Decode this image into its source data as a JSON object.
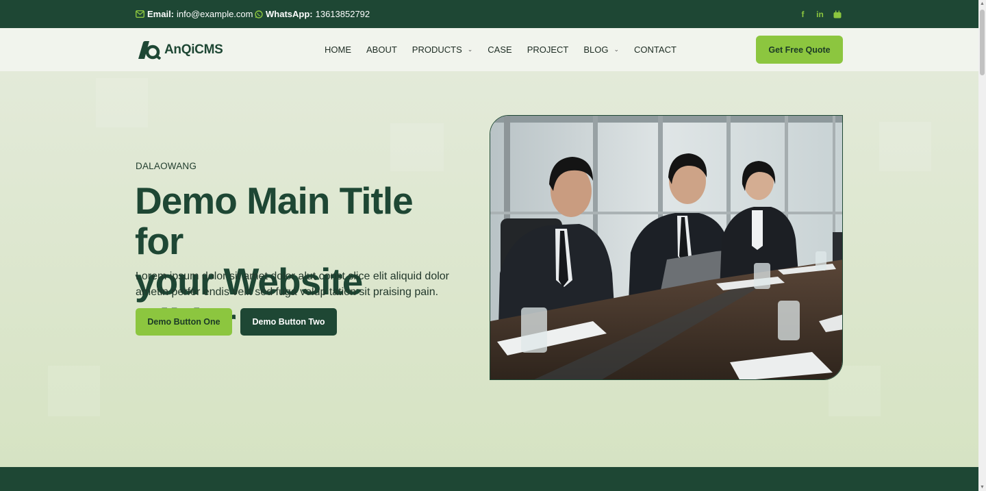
{
  "topbar": {
    "email_label": "Email:",
    "email_value": "info@example.com",
    "whatsapp_label": "WhatsApp:",
    "whatsapp_value": "13613852792",
    "social_icons": [
      "facebook-icon",
      "linkedin-icon",
      "youtube-icon"
    ]
  },
  "header": {
    "logo_text": "AnQiCMS",
    "nav": [
      {
        "label": "HOME",
        "has_dropdown": false
      },
      {
        "label": "ABOUT",
        "has_dropdown": false
      },
      {
        "label": "PRODUCTS",
        "has_dropdown": true
      },
      {
        "label": "CASE",
        "has_dropdown": false
      },
      {
        "label": "PROJECT",
        "has_dropdown": false
      },
      {
        "label": "BLOG",
        "has_dropdown": true
      },
      {
        "label": "CONTACT",
        "has_dropdown": false
      }
    ],
    "quote_button": "Get Free Quote"
  },
  "hero": {
    "eyebrow": "DALAOWANG",
    "title_line1": "Demo Main Title for",
    "title_line2": "your Website Slider",
    "description": "Lorem ipsum dolor sit amet dolor alut const slice elit aliquid dolor ametin perfer endis velit sed fuga volup tation sit praising pain.",
    "button_one": "Demo Button One",
    "button_two": "Demo Button Two"
  },
  "colors": {
    "brand_dark": "#1e4734",
    "accent_green": "#8cc63f",
    "hero_bg": "#dce6cf"
  }
}
